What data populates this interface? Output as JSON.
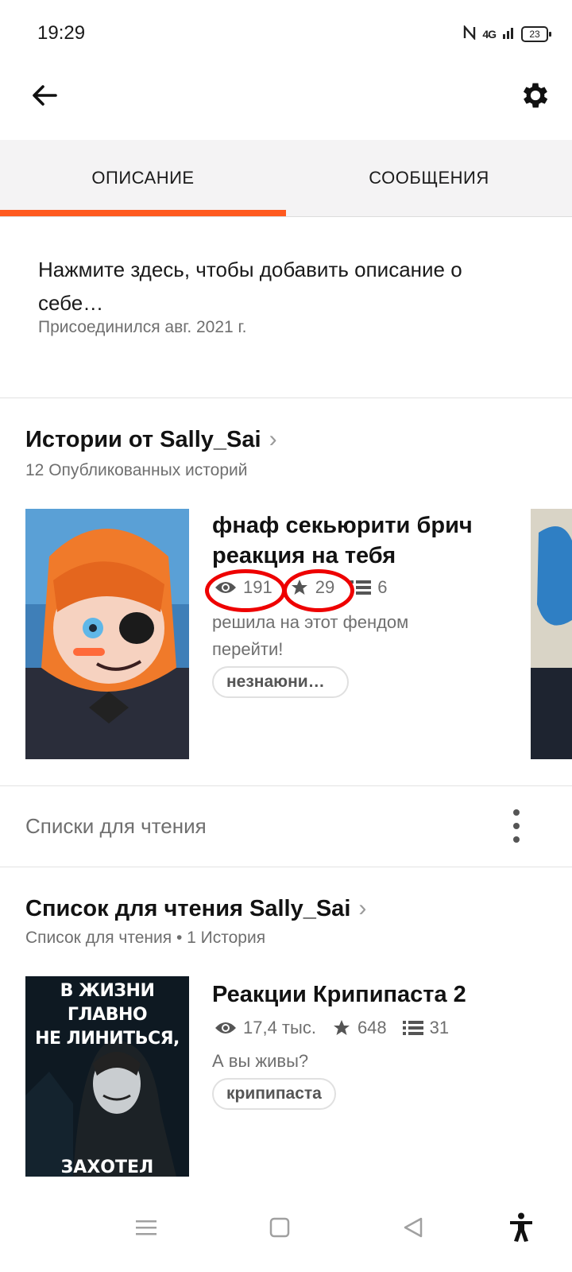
{
  "status_bar": {
    "time": "19:29",
    "network": "4G",
    "battery": "23"
  },
  "header": {
    "back_icon": "arrow-left-icon",
    "settings_icon": "gear-icon"
  },
  "tabs": [
    {
      "label": "ОПИСАНИЕ",
      "active": true
    },
    {
      "label": "СООБЩЕНИЯ",
      "active": false
    }
  ],
  "accent_color": "#ff5a1f",
  "about": {
    "description": "Нажмите здесь, чтобы добавить описание о себе…",
    "joined": "Присоединился авг. 2021 г."
  },
  "stories_section": {
    "title": "Истории от Sally_Sai",
    "subtitle": "12 Опубликованных историй",
    "story": {
      "title": "фнаф секьюрити брич реакция на тебя",
      "views": "191",
      "votes": "29",
      "parts": "6",
      "description": "решила на этот фендом перейти!",
      "tag": "незнаюни…"
    }
  },
  "reading_lists": {
    "label": "Списки для чтения"
  },
  "reading_list_section": {
    "title": "Список для чтения Sally_Sai",
    "subtitle": "Список для чтения • 1 История",
    "story": {
      "cover_text_top": "В ЖИЗНИ ГЛАВНО",
      "cover_text_mid": "НЕ ЛИНИТЬСЯ,",
      "cover_text_bottom": "ЗАХОТЕЛ ПОСПАТ",
      "title": "Реакции Крипипаста 2",
      "views": "17,4 тыс.",
      "votes": "648",
      "parts": "31",
      "description": "А вы живы?",
      "tag": "крипипаста"
    }
  },
  "nav_bar": {
    "icons": [
      "menu-icon",
      "home-square-icon",
      "back-triangle-icon",
      "accessibility-icon"
    ]
  }
}
